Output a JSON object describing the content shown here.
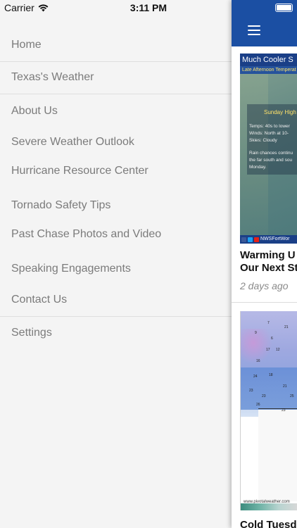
{
  "status_bar": {
    "carrier": "Carrier",
    "time": "3:11 PM",
    "icons": [
      "wifi-icon",
      "battery-icon"
    ]
  },
  "drawer": {
    "items": [
      {
        "label": "Home"
      },
      {
        "label": "Texas's Weather"
      },
      {
        "label": "About Us"
      },
      {
        "label": "Severe Weather Outlook"
      },
      {
        "label": "Hurricane Resource Center"
      },
      {
        "label": "Tornado Safety Tips"
      },
      {
        "label": "Past Chase Photos and Video"
      },
      {
        "label": "Speaking Engagements"
      },
      {
        "label": "Contact Us"
      },
      {
        "label": "Settings"
      }
    ]
  },
  "main": {
    "header_color": "#1b4fa3",
    "menu_icon": "hamburger-menu-icon",
    "cards": [
      {
        "image": {
          "title": "Much Cooler S",
          "subtitle": "Late Afternoon Temperat",
          "box_title": "Sunday High",
          "lines": [
            "Temps:  40s to lower",
            "Winds:  North at 10-",
            "Skies:  Cloudy",
            "",
            "Rain chances continu",
            "the far south and sou",
            "Monday."
          ],
          "footer": "NWSFortWor"
        },
        "title_line1": "Warming U",
        "title_line2": "Our Next St",
        "age": "2 days ago"
      },
      {
        "image": {
          "numbers": [
            "7",
            "21",
            "9",
            "6",
            "17",
            "12",
            "16",
            "24",
            "18",
            "23",
            "23",
            "21",
            "25",
            "26",
            "23"
          ],
          "watermark": "www.pivotalweather.com"
        },
        "title_line1": "Cold Tuesd"
      }
    ]
  }
}
